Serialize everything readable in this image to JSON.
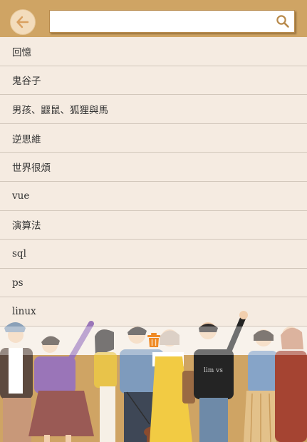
{
  "header": {
    "back_icon": "arrow-left-icon",
    "search": {
      "value": "",
      "placeholder": ""
    },
    "search_icon": "search-icon"
  },
  "history": {
    "items": [
      {
        "label": "回憶"
      },
      {
        "label": "鬼谷子"
      },
      {
        "label": "男孩、鼴鼠、狐狸與馬"
      },
      {
        "label": "逆思維"
      },
      {
        "label": "世界很煩"
      },
      {
        "label": "vue"
      },
      {
        "label": "演算法"
      },
      {
        "label": "sql"
      },
      {
        "label": "ps"
      },
      {
        "label": "linux"
      }
    ]
  },
  "actions": {
    "delete_icon": "trash-icon"
  },
  "colors": {
    "header_bg": "#cfa464",
    "page_bg": "#f5ebe1",
    "accent_orange": "#f08a24",
    "icon_brown": "#b88a4b"
  }
}
